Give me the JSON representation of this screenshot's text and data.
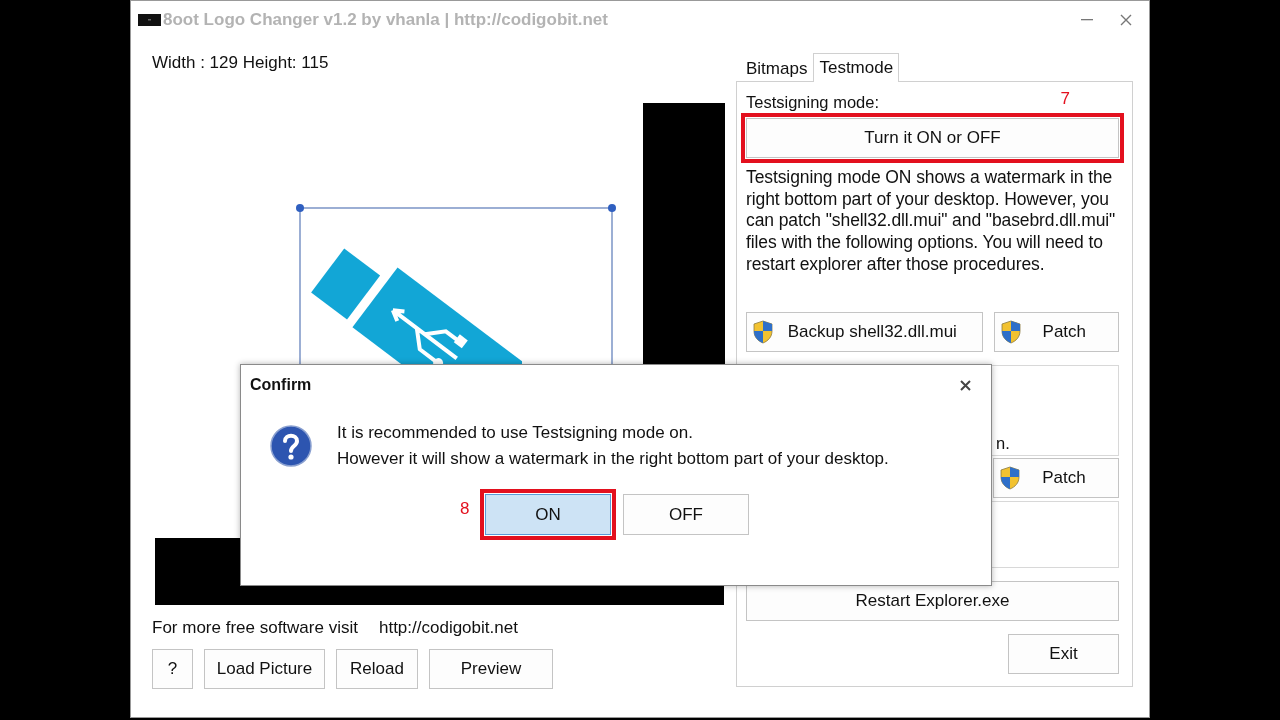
{
  "window": {
    "title": "8oot Logo Changer v1.2 by vhanla | http://codigobit.net"
  },
  "image_info": "Width : 129 Height: 115",
  "footer": {
    "text": "For more free software visit",
    "link": "http://codigobit.net"
  },
  "bottom_buttons": [
    "?",
    "Load Picture",
    "Reload",
    "Preview"
  ],
  "tabs": [
    {
      "label": "Bitmaps",
      "selected": false
    },
    {
      "label": "Testmode",
      "selected": true
    }
  ],
  "testmode": {
    "label": "Testsigning mode:",
    "toggle_button": {
      "label": "Turn it ON or OFF",
      "annotation": "7"
    },
    "description": "Testsigning mode ON shows a watermark in the right bottom part of your desktop. However, you can patch \"shell32.dll.mui\" and \"basebrd.dll.mui\" files with the following options. You will need to restart explorer after those procedures.",
    "shell32_buttons": [
      "Backup shell32.dll.mui",
      "Patch"
    ],
    "group_text": "n.",
    "basebrd_patch_button": "Patch",
    "restart_button": "Restart Explorer.exe",
    "exit_button": "Exit"
  },
  "dialog": {
    "title": "Confirm",
    "lines": [
      "It is recommended to use Testsigning mode on.",
      "However it will show a watermark in the right bottom part of your desktop."
    ],
    "buttons": [
      {
        "label": "ON",
        "selected": true,
        "annotation": "8"
      },
      {
        "label": "OFF",
        "selected": false
      }
    ]
  }
}
